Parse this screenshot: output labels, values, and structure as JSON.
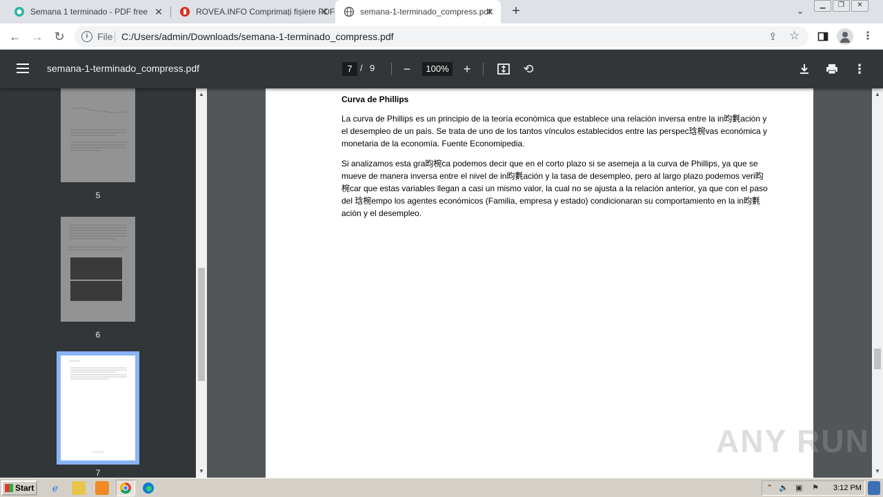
{
  "browser": {
    "tabs": [
      {
        "title": "Semana 1 terminado - PDF free",
        "icon": "globe-teal-icon"
      },
      {
        "title": "ROVEA.INFO Comprimați fișiere PDF",
        "icon": "office-icon"
      },
      {
        "title": "semana-1-terminado_compress.pdf",
        "icon": "globe-icon",
        "active": true
      }
    ],
    "new_tab": "+",
    "address": {
      "scheme_label": "File",
      "url": "C:/Users/admin/Downloads/semana-1-terminado_compress.pdf"
    }
  },
  "pdf_toolbar": {
    "file_name": "semana-1-terminado_compress.pdf",
    "current_page": "7",
    "page_separator": "/",
    "total_pages": "9",
    "zoom": "100%"
  },
  "sidebar": {
    "thumbnails": [
      {
        "label": "5"
      },
      {
        "label": "6"
      },
      {
        "label": "7",
        "selected": true
      }
    ]
  },
  "document": {
    "heading": "Curva de Phillips",
    "paragraphs": [
      "La curva de Phillips es un principio de la teoría económica que establece una relación inversa entre la in昀氀ación y el desempleo de un país. Se trata de uno de los tantos vínculos establecidos entre las perspec琀椀vas económica y monetaria de la economía. Fuente Economipedia.",
      "Si analizamos esta gra昀椀ca podemos decir que en el corto plazo si se asemeja a la curva de Phillips, ya que se mueve de manera inversa entre el nivel de in昀氀ación y la tasa de desempleo, pero al largo plazo podemos veri昀椀car que estas variables llegan a casi un mismo valor, la cual no se ajusta a la relación anterior, ya que con el paso del 琀椀empo los agentes económicos (Familia, empresa y estado) condicionaran su comportamiento en la in昀氀ación y el desempleo."
    ]
  },
  "watermark": "ANY RUN",
  "taskbar": {
    "start_label": "Start",
    "clock": "3:12 PM"
  }
}
